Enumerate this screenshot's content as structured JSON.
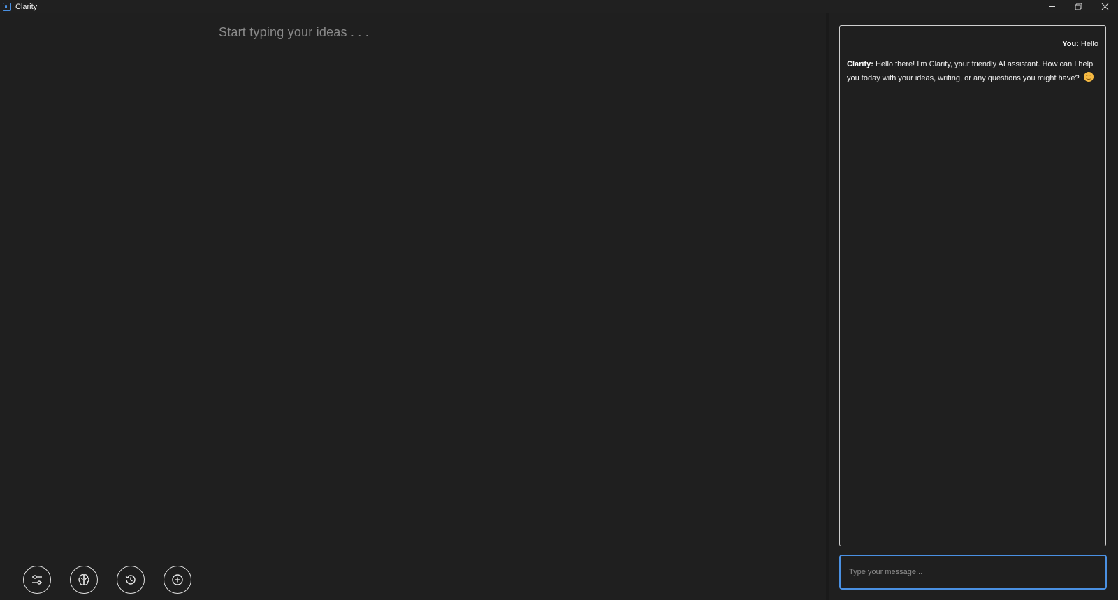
{
  "window": {
    "title": "Clarity",
    "controls": [
      "minimize-icon",
      "restore-icon",
      "close-icon"
    ]
  },
  "editor": {
    "placeholder": "Start typing your ideas . . ."
  },
  "toolbar": {
    "buttons": [
      {
        "name": "settings",
        "icon": "sliders-icon"
      },
      {
        "name": "brain",
        "icon": "brain-icon"
      },
      {
        "name": "history",
        "icon": "history-icon"
      },
      {
        "name": "new",
        "icon": "plus-circle-icon"
      }
    ]
  },
  "chat": {
    "messages": [
      {
        "speaker": "You:",
        "text": "Hello"
      },
      {
        "speaker": "Clarity:",
        "text": "Hello there! I'm Clarity, your friendly AI assistant. How can I help you today with your ideas, writing, or any questions you might have?",
        "emoji": "smiling-face-icon"
      }
    ],
    "input_placeholder": "Type your message..."
  },
  "colors": {
    "background": "#1f1f1f",
    "accent": "#4a90e2",
    "border": "#cfcfcf"
  }
}
